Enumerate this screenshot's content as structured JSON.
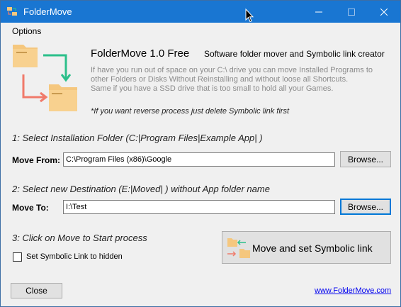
{
  "window": {
    "title": "FolderMove"
  },
  "menu": {
    "options": "Options"
  },
  "header": {
    "app_name": "FolderMove 1.0 Free",
    "tagline": "Software folder mover and Symbolic link creator",
    "desc_lines": [
      "If have you run out of space on your C:\\ drive you can move Installed Programs to",
      "other Folders or Disks Without Reinstalling and without loose all Shortcuts.",
      "Same if you have a SSD drive that is too small to hold all your Games."
    ],
    "note": "*If you want reverse process just delete Symbolic link first"
  },
  "step1": {
    "label": "1: Select Installation Folder (C:|Program Files|Example App| )",
    "field_label": "Move From:",
    "value": "C:\\Program Files (x86)\\Google",
    "browse": "Browse..."
  },
  "step2": {
    "label": "2: Select new Destination (E:|Moved| ) without App folder name",
    "field_label": "Move To:",
    "value": "I:\\Test",
    "browse": "Browse..."
  },
  "step3": {
    "label": "3: Click on Move to Start process",
    "checkbox_label": "Set Symbolic Link to hidden",
    "checkbox_checked": false,
    "move_button": "Move and set Symbolic link"
  },
  "footer": {
    "close": "Close",
    "link": "www.FolderMove.com"
  },
  "colors": {
    "titlebar": "#1976d2",
    "folder": "#f5c77e",
    "arrow_green": "#2bbf8a",
    "arrow_red": "#f07a6a"
  }
}
